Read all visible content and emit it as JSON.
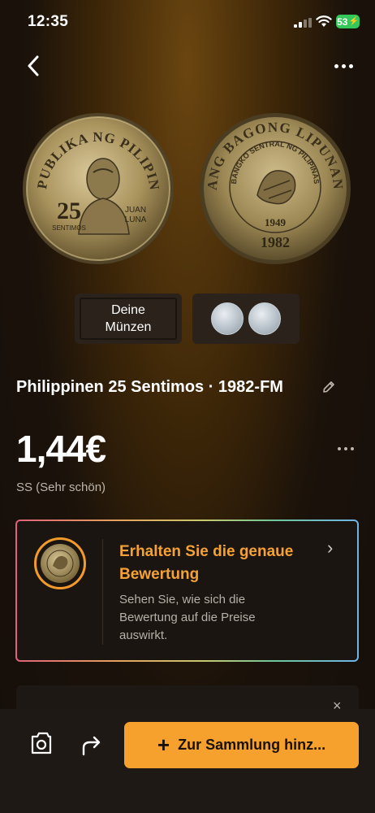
{
  "status_bar": {
    "time": "12:35",
    "battery": "53"
  },
  "icons": {
    "back": "chevron-left-icon",
    "more": "more-horizontal-icon",
    "edit": "pencil-icon",
    "camera": "camera-icon",
    "share": "share-arrow-icon",
    "plus": "plus-icon",
    "close": "close-icon"
  },
  "coin_front": {
    "legend": "REPUBLIKA NG PILIPINAS",
    "value": "25",
    "unit": "SENTIMOS",
    "name_line1": "JUAN",
    "name_line2": "LUNA"
  },
  "coin_back": {
    "legend": "ANG BAGONG LIPUNAN",
    "inner_legend": "BANGKO SENTRAL NG PILIPINAS",
    "inner_year": "1949",
    "year": "1982"
  },
  "thumbnails": {
    "yours_label": "Deine Münzen"
  },
  "coin_title": "Philippinen 25 Sentimos · 1982-FM",
  "price": "1,44€",
  "grade": "SS (Sehr schön)",
  "appraisal_card": {
    "title": "Erhalten Sie die genaue Bewertung",
    "description": "Sehen Sie, wie sich die Bewertung auf die Preise auswirkt.",
    "chevron": "›"
  },
  "peek_card": {
    "close": "×"
  },
  "bottom_bar": {
    "add_label": "Zur Sammlung hinz...",
    "plus": "+"
  },
  "colors": {
    "accent": "#f6a12d",
    "card_title": "#f5a234",
    "battery": "#34c759"
  }
}
